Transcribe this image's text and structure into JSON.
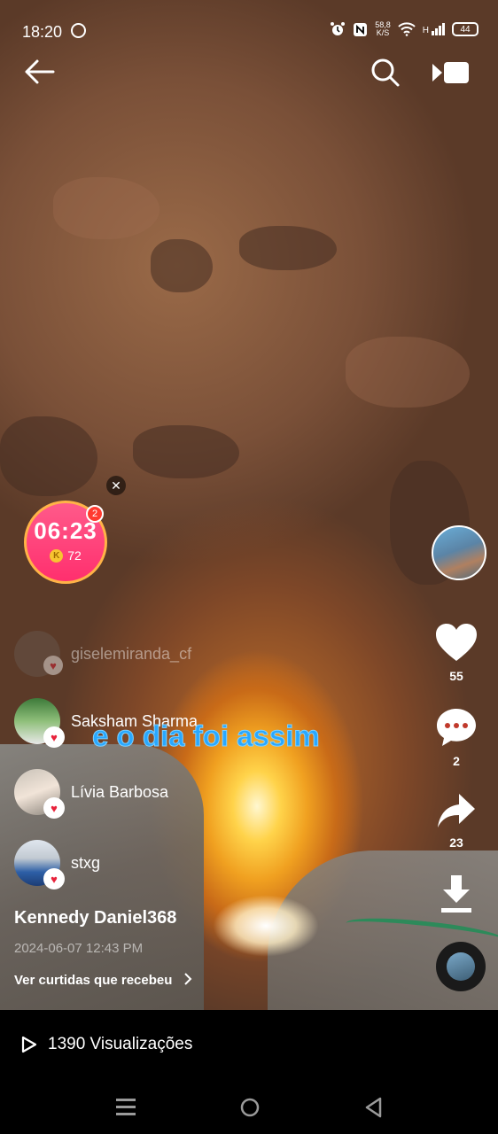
{
  "status_bar": {
    "time": "18:20",
    "speed_value": "58,8",
    "speed_unit": "K/S",
    "network_label": "H",
    "battery": "44"
  },
  "timer": {
    "time": "06:23",
    "coins": "72",
    "coin_symbol": "K",
    "badge": "2"
  },
  "likers": [
    {
      "name": "giselemiranda_cf"
    },
    {
      "name": "Saksham Sharma"
    },
    {
      "name": "Lívia Barbosa"
    },
    {
      "name": "stxg"
    }
  ],
  "overlay_caption": "e o dia foi assim",
  "actions": {
    "likes": "55",
    "comments": "2",
    "shares": "23"
  },
  "post": {
    "author": "Kennedy Daniel368",
    "date": "2024-06-07 12:43 PM",
    "received_likes_link": "Ver curtidas que recebeu"
  },
  "views_label": "1390 Visualizações",
  "icons": {
    "back": "back-arrow-icon",
    "search": "search-icon",
    "video": "video-camera-icon",
    "like": "heart-icon",
    "comment": "comment-icon",
    "share": "share-arrow-icon",
    "download": "download-icon",
    "play": "play-icon"
  },
  "colors": {
    "timer_bg": "#ff2f6e",
    "timer_ring": "#ffb347",
    "caption": "#29a8ff",
    "like_badge": "#e8223b"
  }
}
